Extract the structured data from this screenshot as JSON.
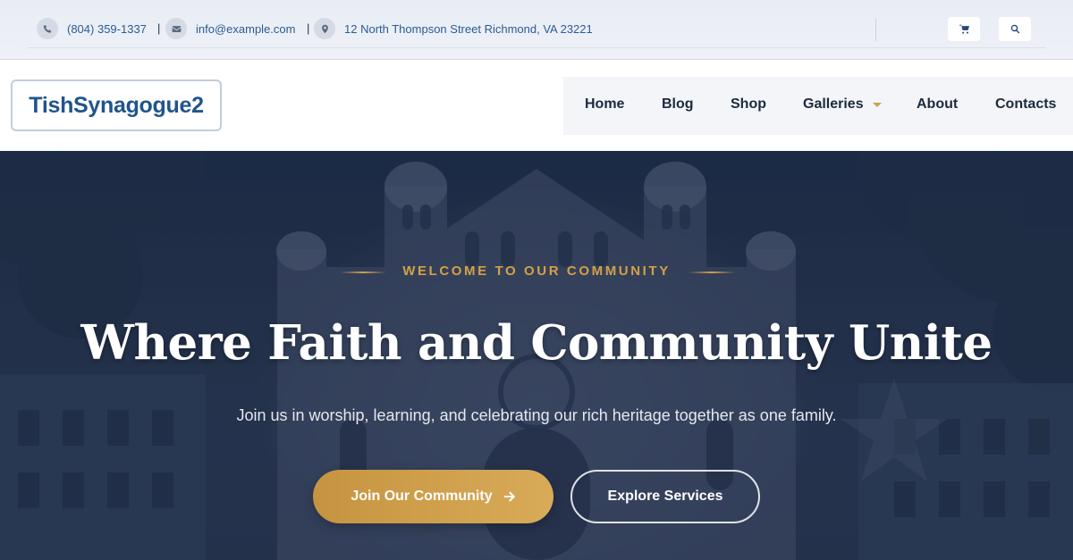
{
  "topbar": {
    "phone": "(804) 359-1337",
    "email": "info@example.com",
    "address": "12 North Thompson Street Richmond, VA 23221",
    "separator": "|",
    "icons": [
      "phone-icon",
      "envelope-icon",
      "map-marker-icon",
      "cart-icon",
      "search-icon"
    ]
  },
  "header": {
    "logo": "TishSynagogue2",
    "nav": [
      "Home",
      "Blog",
      "Shop",
      "Galleries",
      "About",
      "Contacts"
    ]
  },
  "hero": {
    "kicker": "WELCOME TO OUR COMMUNITY",
    "title": "Where Faith and Community Unite",
    "subtitle": "Join us in worship, learning, and celebrating our rich heritage together as one family.",
    "primary_button": "Join Our Community",
    "secondary_button": "Explore Services"
  },
  "colors": {
    "accent_gold": "#d4a045",
    "brand_blue": "#21548e",
    "hero_navy": "#28364f"
  }
}
